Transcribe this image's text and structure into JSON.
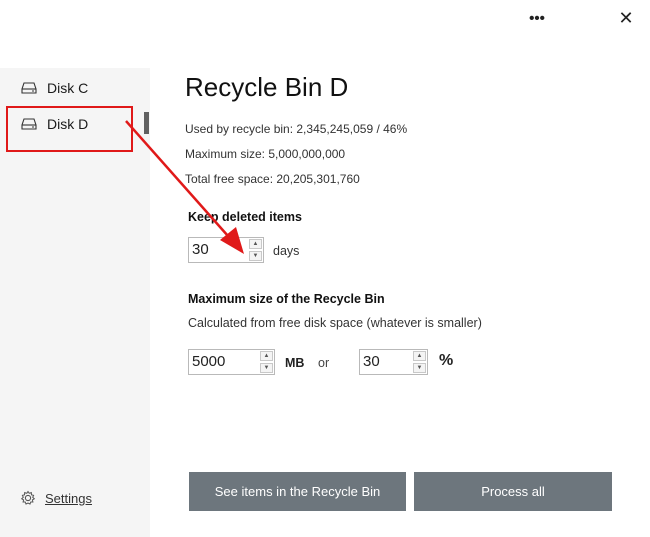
{
  "titlebar": {
    "more_icon": "more-horizontal-icon",
    "more_glyph": "•••",
    "close_icon": "close-icon",
    "close_glyph": "✕"
  },
  "sidebar": {
    "items": [
      {
        "icon": "disk-drive-icon",
        "label": "Disk C"
      },
      {
        "icon": "disk-drive-icon",
        "label": "Disk D",
        "active": true
      }
    ],
    "settings": {
      "icon": "gear-icon",
      "label": "Settings"
    }
  },
  "main": {
    "title": "Recycle Bin D",
    "used_label": "Used by recycle bin: 2,345,245,059 / 46%",
    "max_size_label": "Maximum size: 5,000,000,000",
    "free_space_label": "Total free space: 20,205,301,760",
    "keep_section": {
      "heading": "Keep deleted items",
      "value": "30",
      "unit": "days"
    },
    "max_section": {
      "heading": "Maximum size of the Recycle Bin",
      "subtext": "Calculated from free disk space (whatever is smaller)",
      "mb_value": "5000",
      "mb_unit": "MB",
      "or_label": "or",
      "pct_value": "30",
      "pct_unit": "%"
    },
    "buttons": {
      "see_items": "See items in the Recycle Bin",
      "process_all": "Process all"
    }
  },
  "colors": {
    "annotation_red": "#e01919",
    "button_bg": "#6d767d",
    "sidebar_bg": "#f5f5f5",
    "active_indicator": "#606060"
  }
}
